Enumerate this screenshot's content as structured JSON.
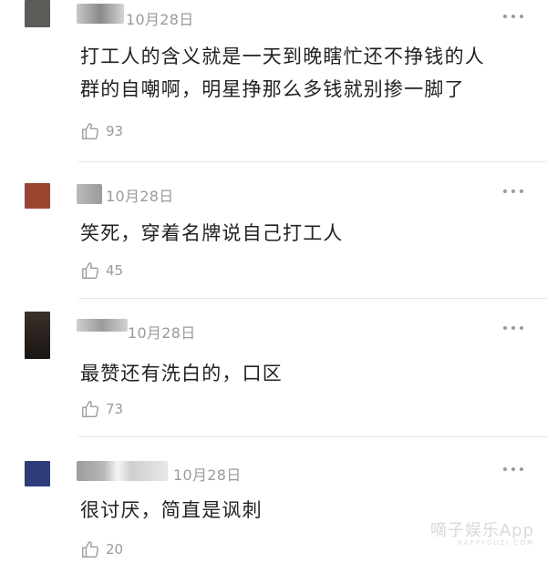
{
  "comments": [
    {
      "date": "10月28日",
      "text_lines": [
        "打工人的含义就是一天到晚瞎忙还不挣钱的人",
        "群的自嘲啊，明星挣那么多钱就别掺一脚了"
      ],
      "likes": "93",
      "avatar_color": "#5b5b57"
    },
    {
      "date": "10月28日",
      "text_lines": [
        "笑死，穿着名牌说自己打工人"
      ],
      "likes": "45",
      "avatar_color": "#9d4430"
    },
    {
      "date": "10月28日",
      "text_lines": [
        "最赞还有洗白的，口区"
      ],
      "likes": "73",
      "avatar_color": "#2a2320"
    },
    {
      "date": "10月28日",
      "text_lines": [
        "很讨厌，简直是讽刺"
      ],
      "likes": "20",
      "avatar_color": "#2d3c7a"
    }
  ],
  "watermark": {
    "main": "嘀子娱乐App",
    "sub": "HAPPYGUZI.COM"
  },
  "icons": {
    "like": "thumbs-up-icon",
    "more": "more-dots-icon"
  }
}
